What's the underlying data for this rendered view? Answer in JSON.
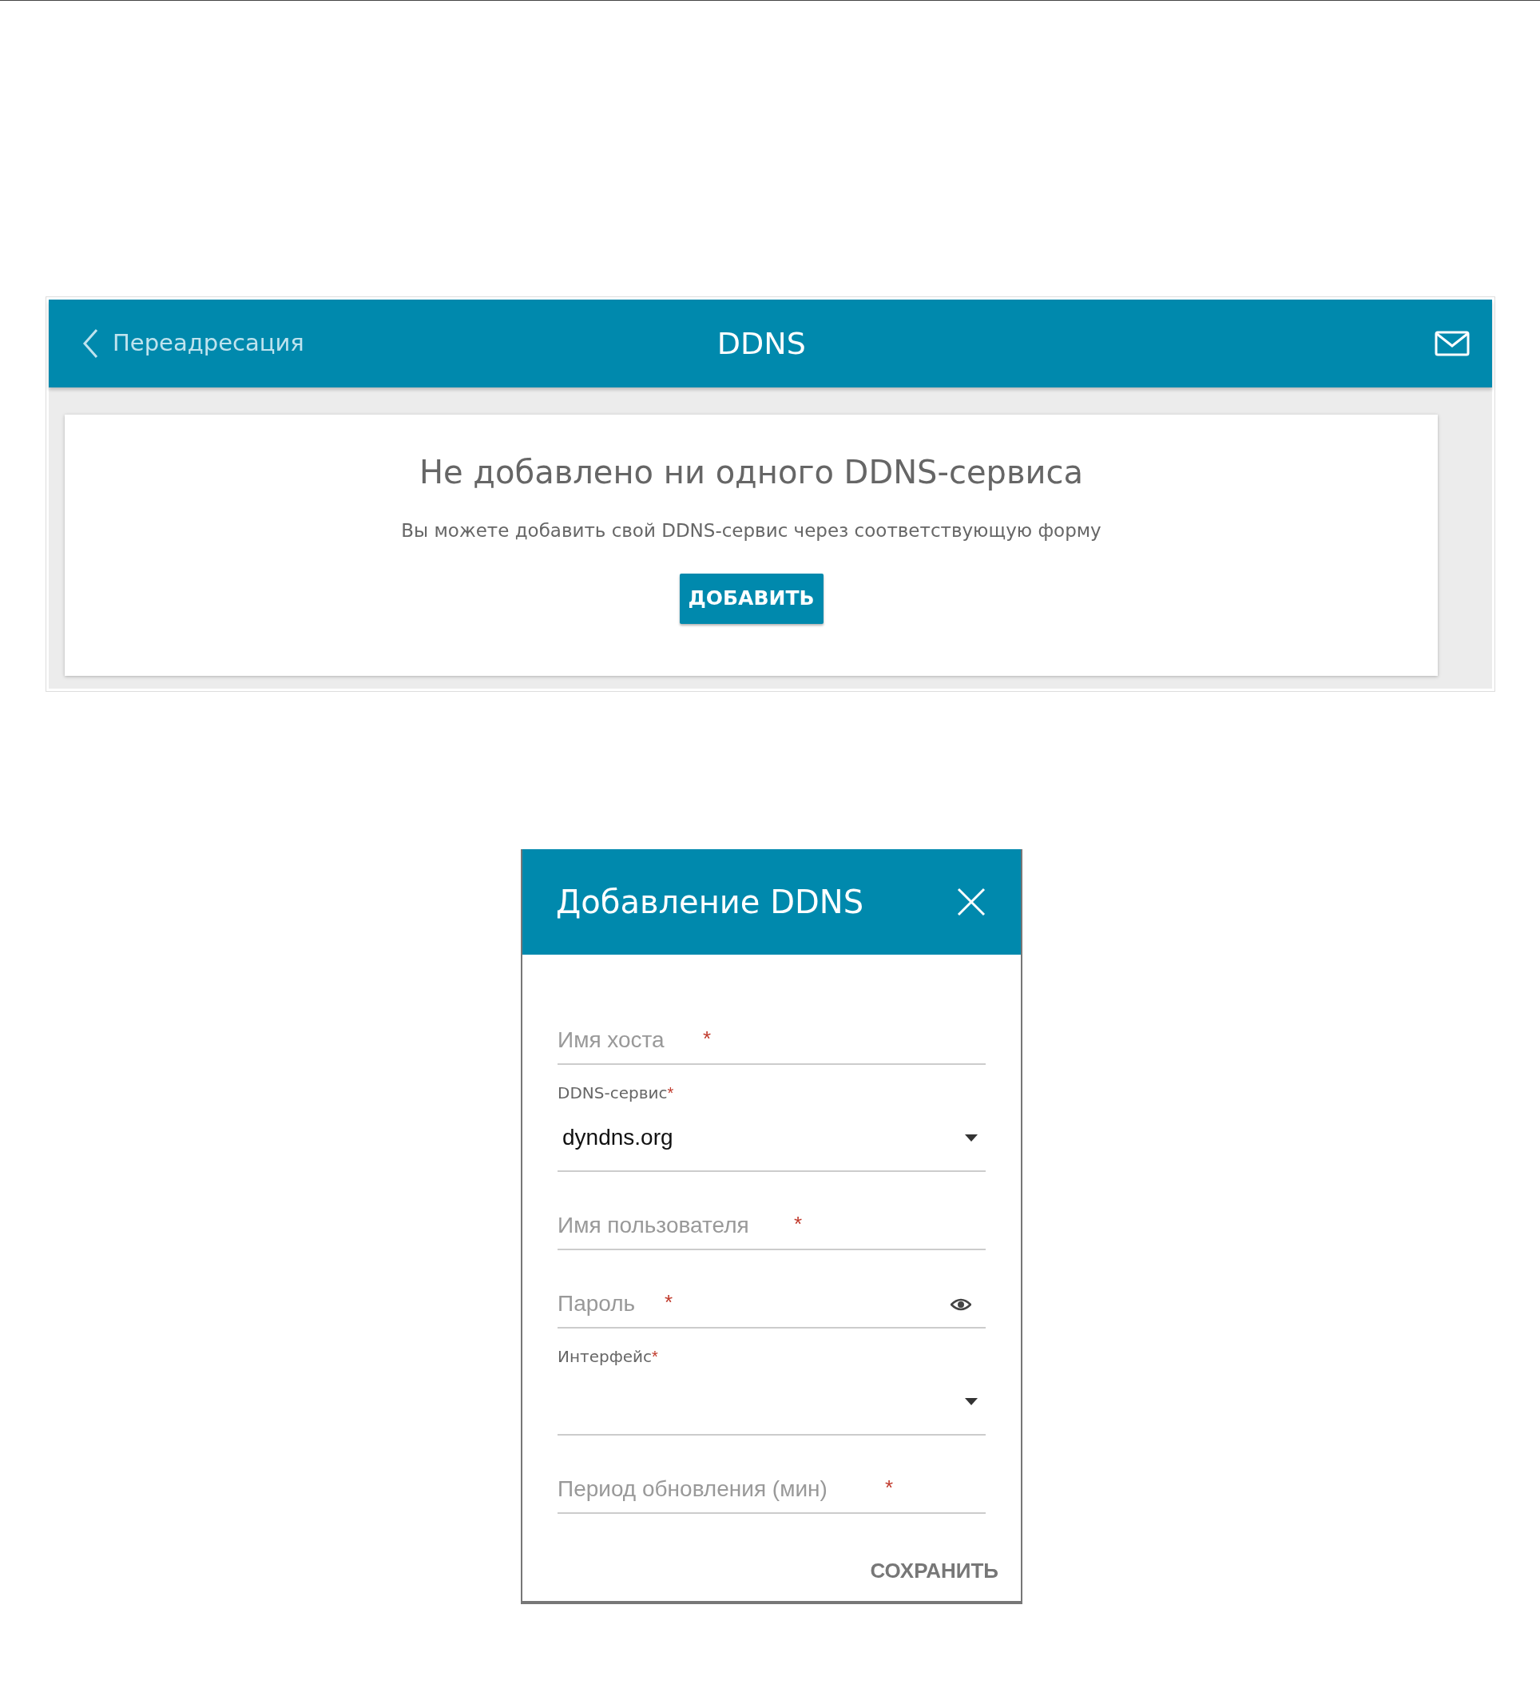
{
  "page": {
    "back_link": "Переадресация",
    "title": "DDNS"
  },
  "empty_card": {
    "title": "Не добавлено ни одного DDNS-сервиса",
    "text": "Вы можете добавить свой DDNS-сервис через соответствующую форму",
    "button": "ДОБАВИТЬ"
  },
  "dialog": {
    "title": "Добавление DDNS",
    "fields": [
      {
        "kind": "text",
        "placeholder": "Имя хоста",
        "required_mark": "*"
      },
      {
        "kind": "select",
        "label": "DDNS-сервис",
        "required_mark": "*",
        "value": "dyndns.org"
      },
      {
        "kind": "text",
        "placeholder": "Имя пользователя",
        "required_mark": "*"
      },
      {
        "kind": "password",
        "placeholder": "Пароль",
        "required_mark": "*"
      },
      {
        "kind": "select",
        "label": "Интерфейс",
        "required_mark": "*"
      },
      {
        "kind": "text",
        "placeholder": "Период обновления (мин)",
        "required_mark": "*"
      }
    ],
    "save_button": "СОХРАНИТЬ"
  }
}
